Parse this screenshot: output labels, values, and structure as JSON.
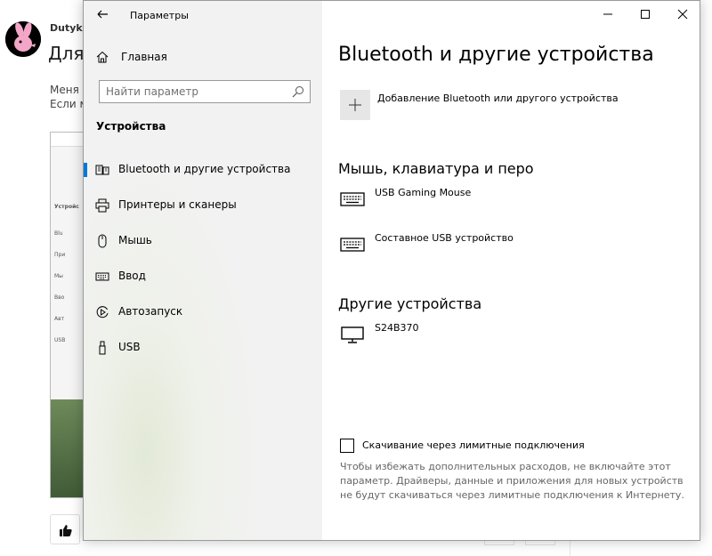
{
  "background": {
    "username": "Dutyk,",
    "post_title": "Для",
    "post_text_line1": "Меня г",
    "post_text_line2": "Если м",
    "thumbnail_rows": [
      "Устройс",
      "Blu",
      "При",
      "Мы",
      "Вво",
      "Авт",
      "USB"
    ]
  },
  "window": {
    "title": "Параметры",
    "nav": {
      "home_label": "Главная",
      "search_placeholder": "Найти параметр",
      "section_title": "Устройства",
      "items": [
        {
          "label": "Bluetooth и другие устройства",
          "icon": "devices-icon",
          "active": true
        },
        {
          "label": "Принтеры и сканеры",
          "icon": "printer-icon",
          "active": false
        },
        {
          "label": "Мышь",
          "icon": "mouse-icon",
          "active": false
        },
        {
          "label": "Ввод",
          "icon": "keyboard-icon",
          "active": false
        },
        {
          "label": "Автозапуск",
          "icon": "autoplay-icon",
          "active": false
        },
        {
          "label": "USB",
          "icon": "usb-icon",
          "active": false
        }
      ]
    },
    "content": {
      "page_title": "Bluetooth и другие устройства",
      "add_device_label": "Добавление Bluetooth или другого устройства",
      "group_input": {
        "title": "Мышь, клавиатура и перо",
        "devices": [
          {
            "name": "USB Gaming Mouse",
            "icon": "keyboard-icon"
          },
          {
            "name": "Составное USB устройство",
            "icon": "keyboard-icon"
          }
        ]
      },
      "group_other": {
        "title": "Другие устройства",
        "devices": [
          {
            "name": "S24B370",
            "icon": "monitor-icon"
          }
        ]
      },
      "metered": {
        "label": "Скачивание через лимитные подключения",
        "checked": false,
        "description": "Чтобы избежать дополнительных расходов, не включайте этот параметр. Драйверы, данные и приложения для новых устройств не будут скачиваться через лимитные подключения к Интернету."
      }
    }
  },
  "colors": {
    "accent": "#0078d7",
    "nav_background": "#f2f2f2",
    "add_button_background": "#e6e6e6"
  }
}
